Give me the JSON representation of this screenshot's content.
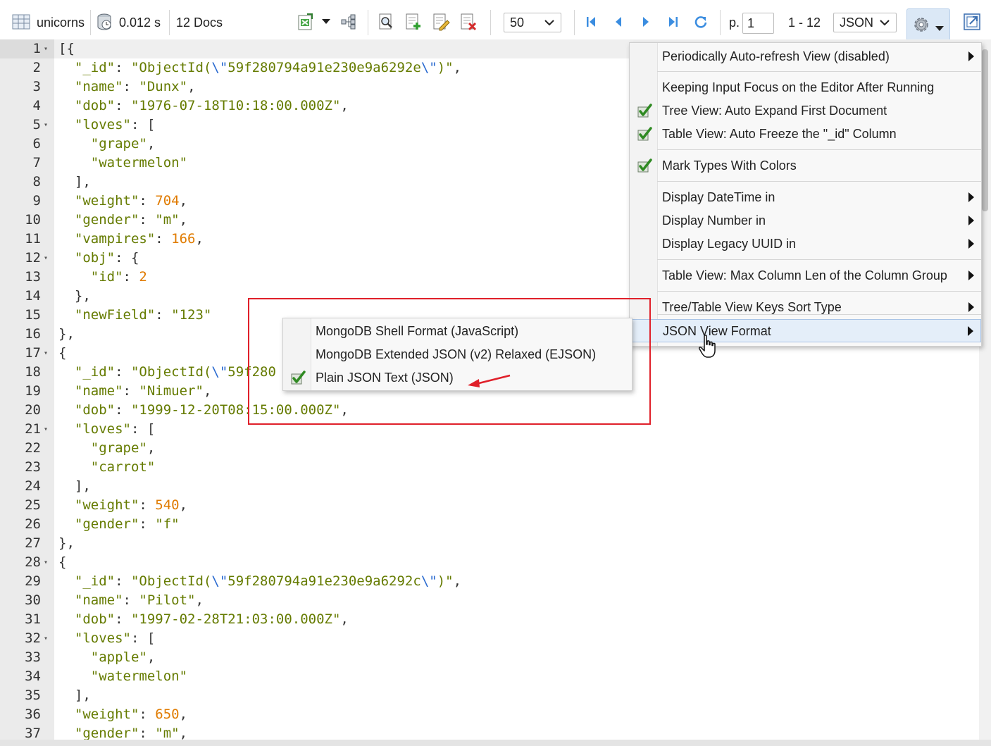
{
  "toolbar": {
    "collection_name": "unicorns",
    "elapsed": "0.012 s",
    "doc_count": "12 Docs",
    "page_size": "50",
    "page_label": "p.",
    "page_number": "1",
    "range": "1 - 12",
    "view_format": "JSON"
  },
  "editor": {
    "lines": [
      {
        "n": "1",
        "fold": true,
        "html": "<span class='pun'>[{</span>"
      },
      {
        "n": "2",
        "fold": false,
        "html": "  <span class='key'>\"_id\"</span><span class='pun'>: </span><span class='str'>\"ObjectId(<span class='esc'>\\\"</span>59f280794a91e230e9a6292e<span class='esc'>\\\"</span>)\"</span><span class='pun'>,</span>"
      },
      {
        "n": "3",
        "fold": false,
        "html": "  <span class='key'>\"name\"</span><span class='pun'>: </span><span class='str'>\"Dunx\"</span><span class='pun'>,</span>"
      },
      {
        "n": "4",
        "fold": false,
        "html": "  <span class='key'>\"dob\"</span><span class='pun'>: </span><span class='str'>\"1976-07-18T10:18:00.000Z\"</span><span class='pun'>,</span>"
      },
      {
        "n": "5",
        "fold": true,
        "html": "  <span class='key'>\"loves\"</span><span class='pun'>: [</span>"
      },
      {
        "n": "6",
        "fold": false,
        "html": "    <span class='str'>\"grape\"</span><span class='pun'>,</span>"
      },
      {
        "n": "7",
        "fold": false,
        "html": "    <span class='str'>\"watermelon\"</span>"
      },
      {
        "n": "8",
        "fold": false,
        "html": "  <span class='pun'>],</span>"
      },
      {
        "n": "9",
        "fold": false,
        "html": "  <span class='key'>\"weight\"</span><span class='pun'>: </span><span class='num'>704</span><span class='pun'>,</span>"
      },
      {
        "n": "10",
        "fold": false,
        "html": "  <span class='key'>\"gender\"</span><span class='pun'>: </span><span class='str'>\"m\"</span><span class='pun'>,</span>"
      },
      {
        "n": "11",
        "fold": false,
        "html": "  <span class='key'>\"vampires\"</span><span class='pun'>: </span><span class='num'>166</span><span class='pun'>,</span>"
      },
      {
        "n": "12",
        "fold": true,
        "html": "  <span class='key'>\"obj\"</span><span class='pun'>: {</span>"
      },
      {
        "n": "13",
        "fold": false,
        "html": "    <span class='key'>\"id\"</span><span class='pun'>: </span><span class='num'>2</span>"
      },
      {
        "n": "14",
        "fold": false,
        "html": "  <span class='pun'>},</span>"
      },
      {
        "n": "15",
        "fold": false,
        "html": "  <span class='key'>\"newField\"</span><span class='pun'>: </span><span class='str'>\"123\"</span>"
      },
      {
        "n": "16",
        "fold": false,
        "html": "<span class='pun'>},</span>"
      },
      {
        "n": "17",
        "fold": true,
        "html": "<span class='pun'>{</span>"
      },
      {
        "n": "18",
        "fold": false,
        "html": "  <span class='key'>\"_id\"</span><span class='pun'>: </span><span class='str'>\"ObjectId(<span class='esc'>\\\"</span>59f280</span>"
      },
      {
        "n": "19",
        "fold": false,
        "html": "  <span class='key'>\"name\"</span><span class='pun'>: </span><span class='str'>\"Nimuer\"</span><span class='pun'>,</span>"
      },
      {
        "n": "20",
        "fold": false,
        "html": "  <span class='key'>\"dob\"</span><span class='pun'>: </span><span class='str'>\"1999-12-20T08:15:00.000Z\"</span><span class='pun'>,</span>"
      },
      {
        "n": "21",
        "fold": true,
        "html": "  <span class='key'>\"loves\"</span><span class='pun'>: [</span>"
      },
      {
        "n": "22",
        "fold": false,
        "html": "    <span class='str'>\"grape\"</span><span class='pun'>,</span>"
      },
      {
        "n": "23",
        "fold": false,
        "html": "    <span class='str'>\"carrot\"</span>"
      },
      {
        "n": "24",
        "fold": false,
        "html": "  <span class='pun'>],</span>"
      },
      {
        "n": "25",
        "fold": false,
        "html": "  <span class='key'>\"weight\"</span><span class='pun'>: </span><span class='num'>540</span><span class='pun'>,</span>"
      },
      {
        "n": "26",
        "fold": false,
        "html": "  <span class='key'>\"gender\"</span><span class='pun'>: </span><span class='str'>\"f\"</span>"
      },
      {
        "n": "27",
        "fold": false,
        "html": "<span class='pun'>},</span>"
      },
      {
        "n": "28",
        "fold": true,
        "html": "<span class='pun'>{</span>"
      },
      {
        "n": "29",
        "fold": false,
        "html": "  <span class='key'>\"_id\"</span><span class='pun'>: </span><span class='str'>\"ObjectId(<span class='esc'>\\\"</span>59f280794a91e230e9a6292c<span class='esc'>\\\"</span>)\"</span><span class='pun'>,</span>"
      },
      {
        "n": "30",
        "fold": false,
        "html": "  <span class='key'>\"name\"</span><span class='pun'>: </span><span class='str'>\"Pilot\"</span><span class='pun'>,</span>"
      },
      {
        "n": "31",
        "fold": false,
        "html": "  <span class='key'>\"dob\"</span><span class='pun'>: </span><span class='str'>\"1997-02-28T21:03:00.000Z\"</span><span class='pun'>,</span>"
      },
      {
        "n": "32",
        "fold": true,
        "html": "  <span class='key'>\"loves\"</span><span class='pun'>: [</span>"
      },
      {
        "n": "33",
        "fold": false,
        "html": "    <span class='str'>\"apple\"</span><span class='pun'>,</span>"
      },
      {
        "n": "34",
        "fold": false,
        "html": "    <span class='str'>\"watermelon\"</span>"
      },
      {
        "n": "35",
        "fold": false,
        "html": "  <span class='pun'>],</span>"
      },
      {
        "n": "36",
        "fold": false,
        "html": "  <span class='key'>\"weight\"</span><span class='pun'>: </span><span class='num'>650</span><span class='pun'>,</span>"
      },
      {
        "n": "37",
        "fold": false,
        "html": "  <span class='key'>\"gender\"</span><span class='pun'>: </span><span class='str'>\"m\"</span><span class='pun'>,</span>"
      }
    ]
  },
  "settings_menu": {
    "items": [
      {
        "label": "Periodically Auto-refresh View (disabled)",
        "submenu": true,
        "checked": false
      },
      {
        "label": "Keeping Input Focus on the Editor After Running",
        "submenu": false,
        "checked": false
      },
      {
        "label": "Tree View: Auto Expand First Document",
        "submenu": false,
        "checked": true
      },
      {
        "label": "Table View: Auto Freeze the \"_id\" Column",
        "submenu": false,
        "checked": true
      },
      {
        "label": "Mark Types With Colors",
        "submenu": false,
        "checked": true
      },
      {
        "label": "Display DateTime in",
        "submenu": true,
        "checked": false
      },
      {
        "label": "Display Number in",
        "submenu": true,
        "checked": false
      },
      {
        "label": "Display Legacy UUID in",
        "submenu": true,
        "checked": false
      },
      {
        "label": "Table View: Max Column Len of the Column Group",
        "submenu": true,
        "checked": false
      },
      {
        "label": "Tree/Table View Keys Sort Type",
        "submenu": true,
        "checked": false
      },
      {
        "label": "JSON View Format",
        "submenu": true,
        "checked": false,
        "highlighted": true
      }
    ]
  },
  "json_format_submenu": {
    "items": [
      {
        "label": "MongoDB Shell Format (JavaScript)",
        "checked": false
      },
      {
        "label": "MongoDB Extended JSON (v2) Relaxed (EJSON)",
        "checked": false
      },
      {
        "label": "Plain JSON Text (JSON)",
        "checked": true
      }
    ]
  },
  "colors": {
    "annotation_red": "#e0202a",
    "json_key": "#657b00",
    "json_number": "#e07b00",
    "menu_highlight": "#e4eef9",
    "check_green": "#3a9a2e"
  },
  "icons": [
    "table-icon",
    "timer-icon",
    "export-icon",
    "dropdown-caret-icon",
    "tree-icon",
    "find-icon",
    "insert-doc-icon",
    "edit-doc-icon",
    "delete-doc-icon",
    "first-page-icon",
    "prev-page-icon",
    "next-page-icon",
    "last-page-icon",
    "refresh-icon",
    "gear-icon",
    "popout-icon",
    "checkmark-icon",
    "submenu-arrow-icon",
    "hand-cursor-icon",
    "red-arrow-annotation"
  ]
}
